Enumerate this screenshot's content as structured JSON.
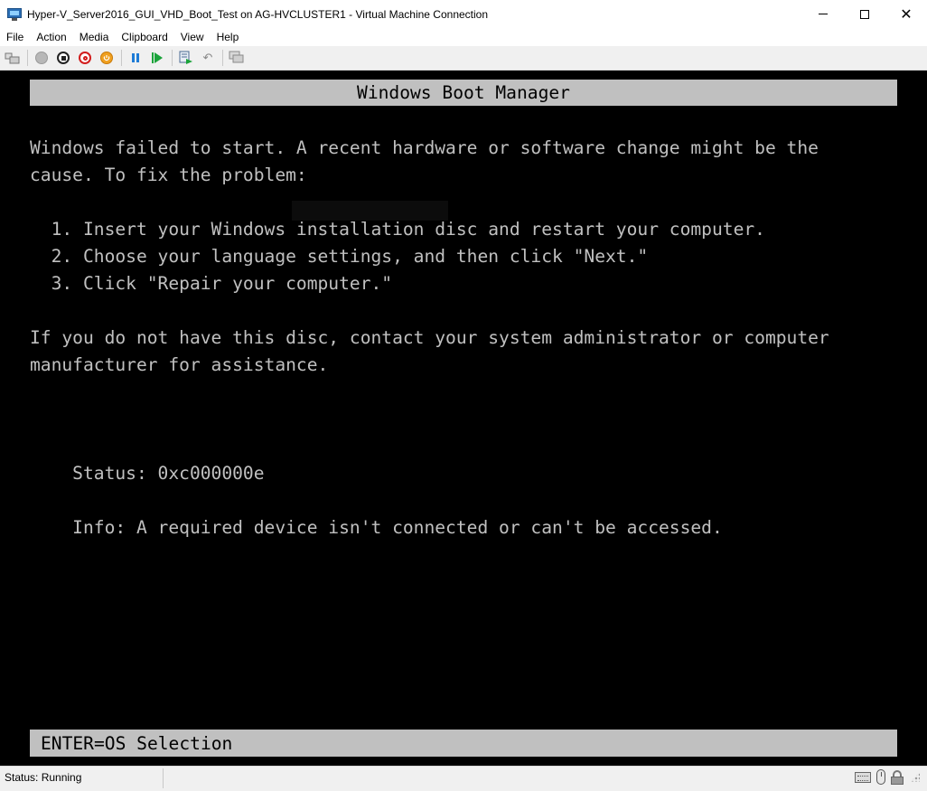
{
  "window": {
    "title": "Hyper-V_Server2016_GUI_VHD_Boot_Test on AG-HVCLUSTER1 - Virtual Machine Connection",
    "close_glyph": "✕"
  },
  "menu": {
    "items": [
      "File",
      "Action",
      "Media",
      "Clipboard",
      "View",
      "Help"
    ]
  },
  "toolbar": {
    "buttons": [
      "ctrl-alt-del",
      "start",
      "turn-off",
      "shut-down",
      "save",
      "pause",
      "reset",
      "checkpoint",
      "revert",
      "enhanced-session"
    ],
    "colors": {
      "pause": "#1e7bd6",
      "reset": "#1aa33a",
      "shut_down": "#d21d1d",
      "save": "#f0a020"
    }
  },
  "boot": {
    "header": "Windows Boot Manager",
    "line1": "Windows failed to start. A recent hardware or software change might be the",
    "line2": "cause. To fix the problem:",
    "steps": [
      "  1. Insert your Windows installation disc and restart your computer.",
      "  2. Choose your language settings, and then click \"Next.\"",
      "  3. Click \"Repair your computer.\""
    ],
    "line3": "If you do not have this disc, contact your system administrator or computer",
    "line4": "manufacturer for assistance.",
    "status_line": "    Status: 0xc000000e",
    "info_line": "    Info: A required device isn't connected or can't be accessed.",
    "footer": "ENTER=OS Selection",
    "colors": {
      "background": "#000000",
      "text": "#c0c0c0",
      "bar": "#c0c0c0"
    }
  },
  "statusbar": {
    "text": "Status: Running"
  }
}
